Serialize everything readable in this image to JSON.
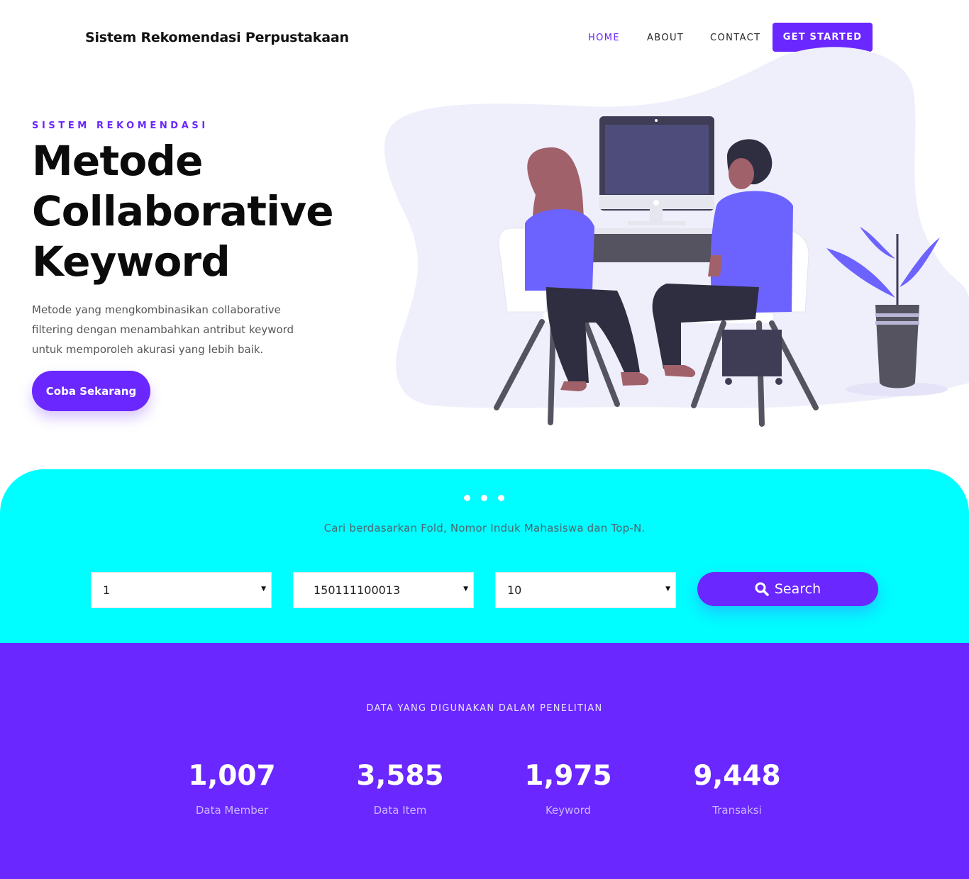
{
  "nav": {
    "brand": "Sistem Rekomendasi Perpustakaan",
    "links": [
      "HOME",
      "ABOUT",
      "CONTACT"
    ],
    "active": "HOME",
    "cta": "GET STARTED"
  },
  "hero": {
    "eyebrow": "SISTEM REKOMENDASI",
    "title_lines": [
      "Metode",
      "Collaborative",
      "Keyword"
    ],
    "description": "Metode yang mengkombinasikan collaborative filtering dengan menambahkan antribut keyword untuk memporoleh akurasi yang lebih baik.",
    "button": "Coba Sekarang"
  },
  "search": {
    "caption": "Cari berdasarkan Fold, Nomor Induk Mahasiswa dan Top-N.",
    "fold_value": "1",
    "nim_value": "150111100013",
    "topn_value": "10",
    "button": "Search",
    "search_icon": "search-icon"
  },
  "stats": {
    "heading": "DATA YANG DIGUNAKAN DALAM PENELITIAN",
    "items": [
      {
        "value": "1,007",
        "label": "Data Member"
      },
      {
        "value": "3,585",
        "label": "Data Item"
      },
      {
        "value": "1,975",
        "label": "Keyword"
      },
      {
        "value": "9,448",
        "label": "Transaksi"
      }
    ]
  },
  "colors": {
    "accent": "#6a27ff",
    "search_bg": "#00fdff",
    "stats_bg": "#6a27ff"
  }
}
